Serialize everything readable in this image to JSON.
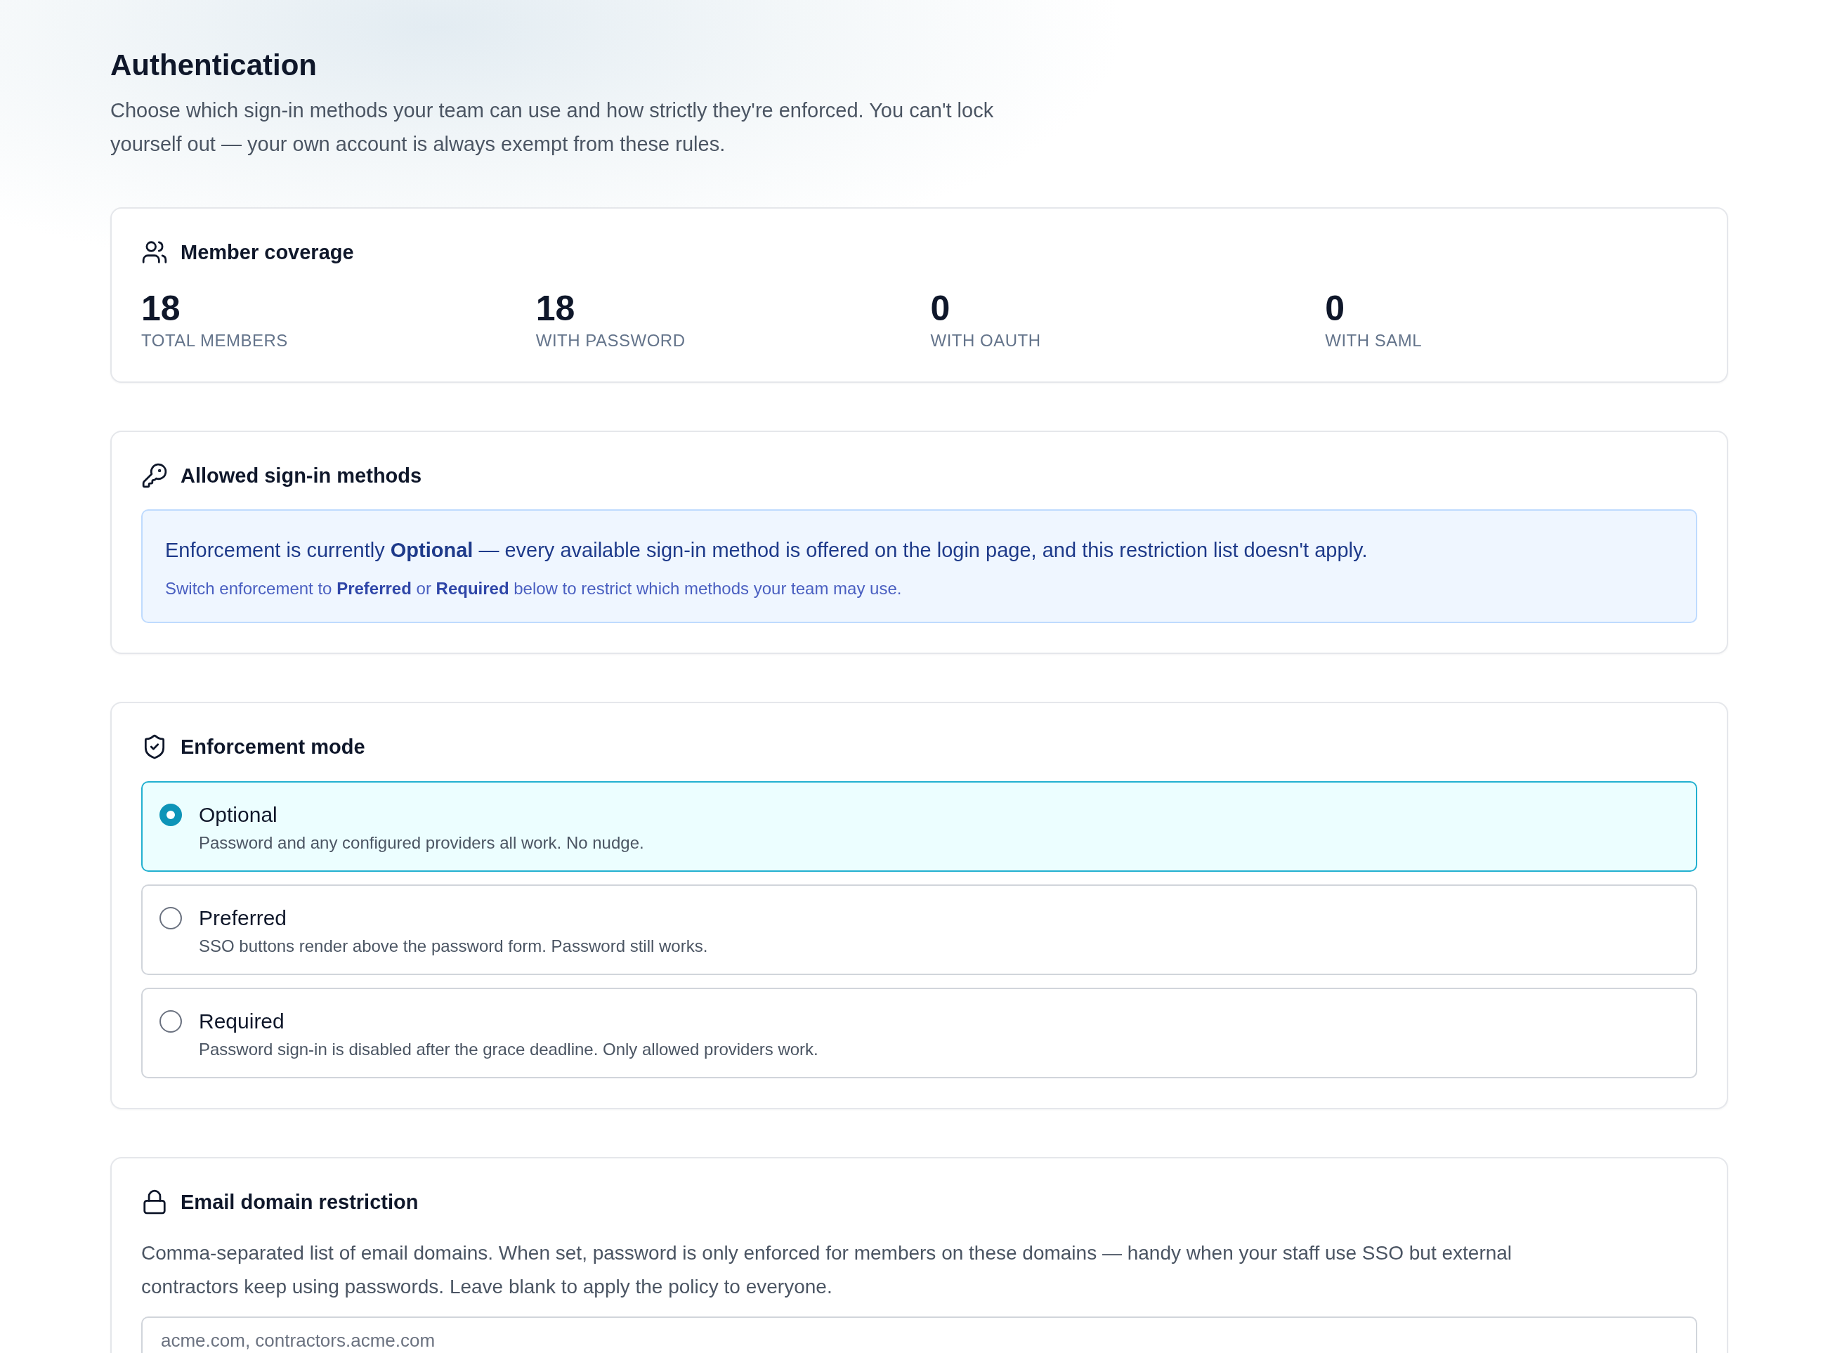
{
  "page": {
    "title": "Authentication",
    "description": "Choose which sign-in methods your team can use and how strictly they're enforced. You can't lock yourself out — your own account is always exempt from these rules."
  },
  "member_coverage": {
    "title": "Member coverage",
    "stats": [
      {
        "value": "18",
        "label": "TOTAL MEMBERS"
      },
      {
        "value": "18",
        "label": "WITH PASSWORD"
      },
      {
        "value": "0",
        "label": "WITH OAUTH"
      },
      {
        "value": "0",
        "label": "WITH SAML"
      }
    ]
  },
  "sign_in_methods": {
    "title": "Allowed sign-in methods",
    "notice": {
      "message": "Enforcement is currently **Optional** — every available sign-in method is offered on the login page, and this restriction list doesn't apply.",
      "hint": "Switch enforcement to **Preferred** or **Required** below to restrict which methods your team may use."
    }
  },
  "enforcement_mode": {
    "title": "Enforcement mode",
    "options": [
      {
        "label": "Optional",
        "description": "Password and any configured providers all work. No nudge.",
        "selected": true
      },
      {
        "label": "Preferred",
        "description": "SSO buttons render above the password form. Password still works.",
        "selected": false
      },
      {
        "label": "Required",
        "description": "Password sign-in is disabled after the grace deadline. Only allowed providers work.",
        "selected": false
      }
    ]
  },
  "email_domain_restriction": {
    "title": "Email domain restriction",
    "description": "Comma-separated list of email domains. When set, password is only enforced for members on these domains — handy when your staff use SSO but external contractors keep using passwords. Leave blank to apply the policy to everyone.",
    "input": {
      "placeholder": "acme.com, contractors.acme.com"
    }
  }
}
